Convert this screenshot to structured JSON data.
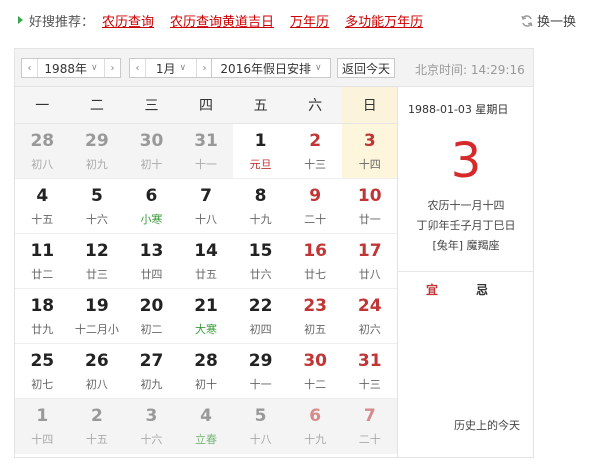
{
  "top": {
    "label": "好搜推荐：",
    "links": [
      "农历查询",
      "农历查询黄道吉日",
      "万年历",
      "多功能万年历"
    ],
    "refresh_label": "换一换"
  },
  "controls": {
    "year": "1988年",
    "month": "1月",
    "holiday": "2016年假日安排",
    "today_button": "返回今天",
    "beijing_time": "北京时间: 14:29:16"
  },
  "weekdays": [
    "一",
    "二",
    "三",
    "四",
    "五",
    "六",
    "日"
  ],
  "rows": [
    [
      [
        "28",
        "初八",
        "o"
      ],
      [
        "29",
        "初九",
        "o"
      ],
      [
        "30",
        "初十",
        "o"
      ],
      [
        "31",
        "十一",
        "o"
      ],
      [
        "1",
        "元旦",
        "f"
      ],
      [
        "2",
        "十三",
        "w"
      ],
      [
        "3",
        "十四",
        "ws"
      ]
    ],
    [
      [
        "4",
        "十五",
        ""
      ],
      [
        "5",
        "十六",
        ""
      ],
      [
        "6",
        "小寒",
        "t"
      ],
      [
        "7",
        "十八",
        ""
      ],
      [
        "8",
        "十九",
        ""
      ],
      [
        "9",
        "二十",
        "w"
      ],
      [
        "10",
        "廿一",
        "w"
      ]
    ],
    [
      [
        "11",
        "廿二",
        ""
      ],
      [
        "12",
        "廿三",
        ""
      ],
      [
        "13",
        "廿四",
        ""
      ],
      [
        "14",
        "廿五",
        ""
      ],
      [
        "15",
        "廿六",
        ""
      ],
      [
        "16",
        "廿七",
        "w"
      ],
      [
        "17",
        "廿八",
        "w"
      ]
    ],
    [
      [
        "18",
        "廿九",
        ""
      ],
      [
        "19",
        "十二月小",
        ""
      ],
      [
        "20",
        "初二",
        ""
      ],
      [
        "21",
        "大寒",
        "t"
      ],
      [
        "22",
        "初四",
        ""
      ],
      [
        "23",
        "初五",
        "w"
      ],
      [
        "24",
        "初六",
        "w"
      ]
    ],
    [
      [
        "25",
        "初七",
        ""
      ],
      [
        "26",
        "初八",
        ""
      ],
      [
        "27",
        "初九",
        ""
      ],
      [
        "28",
        "初十",
        ""
      ],
      [
        "29",
        "十一",
        ""
      ],
      [
        "30",
        "十二",
        "w"
      ],
      [
        "31",
        "十三",
        "w"
      ]
    ],
    [
      [
        "1",
        "十四",
        "o"
      ],
      [
        "2",
        "十五",
        "o"
      ],
      [
        "3",
        "十六",
        "o"
      ],
      [
        "4",
        "立春",
        "ot"
      ],
      [
        "5",
        "十八",
        "o"
      ],
      [
        "6",
        "十九",
        "ow"
      ],
      [
        "7",
        "二十",
        "ow"
      ]
    ]
  ],
  "detail": {
    "date_line": "1988-01-03 星期日",
    "big_day": "3",
    "lunar_line": "农历十一月十四",
    "ganzhi_line": "丁卯年壬子月丁巳日",
    "zodiac_line": "[兔年] 魔羯座",
    "yi": "宜",
    "ji": "忌",
    "history": "历史上的今天"
  },
  "colors": {
    "accent_red": "#d62a2a",
    "solar_term_green": "#3c9a3c",
    "selected_bg": "#fdf6dc"
  }
}
